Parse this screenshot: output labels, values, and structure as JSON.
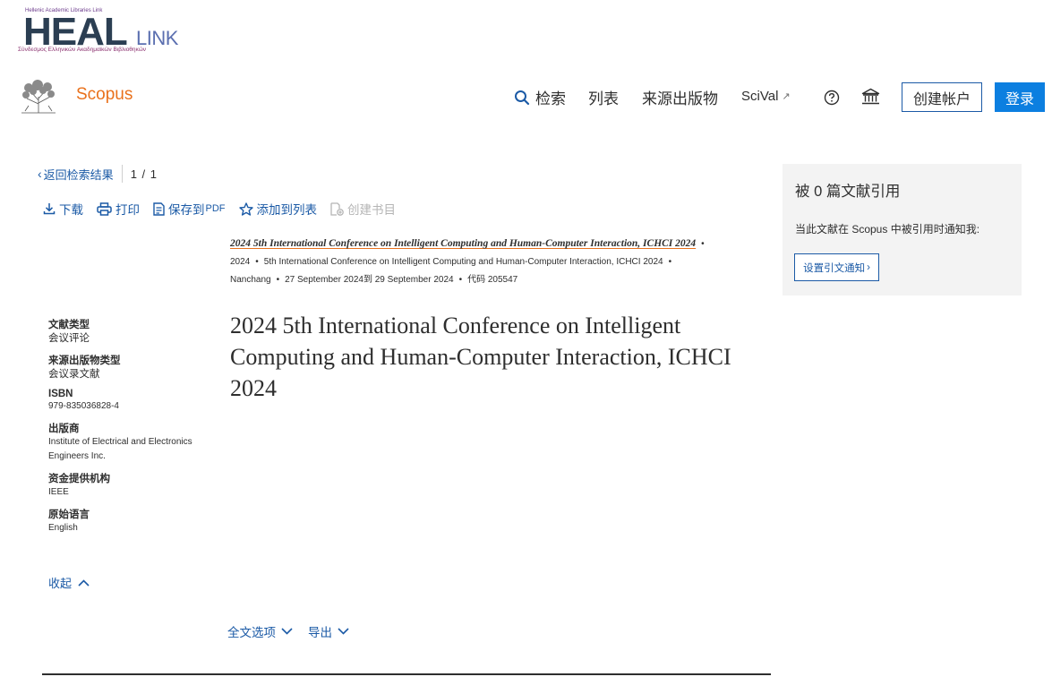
{
  "heal_banner": {
    "small_text": "Hellenic Academic Libraries Link",
    "big_text": "HEAL",
    "link_text": "LINK",
    "sub_text": "Σύνδεσμος Ελληνικών Ακαδημαϊκών Βιβλιοθηκών"
  },
  "header": {
    "brand": "Scopus",
    "nav": {
      "search": "检索",
      "lists": "列表",
      "sources": "来源出版物",
      "scival": "SciVal",
      "scival_ext": "↗"
    },
    "create_account": "创建帐户",
    "login": "登录",
    "icons": [
      "search-icon",
      "help-icon",
      "institution-icon",
      "external-link-icon"
    ]
  },
  "nav_row": {
    "back_label": "返回检索结果",
    "pager": "1 / 1"
  },
  "toolbar": {
    "download": "下载",
    "print": "打印",
    "save_pdf": "保存到",
    "save_pdf_suffix": "PDF",
    "add_to_list": "添加到列表",
    "create_bib": "创建书目"
  },
  "source": {
    "title": "2024 5th International Conference on Intelligent Computing and Human-Computer Interaction, ICHCI 2024",
    "year": "2024",
    "conf": "5th International Conference on Intelligent Computing and Human-Computer Interaction, ICHCI 2024",
    "location": "Nanchang",
    "dates": "27 September 2024到 29 September 2024",
    "code": "代码 205547"
  },
  "document": {
    "title": "2024 5th International Conference on Intelligent Computing and Human-Computer Interaction, ICHCI 2024"
  },
  "metadata": {
    "doc_type_label": "文献类型",
    "doc_type_value": "会议评论",
    "source_type_label": "来源出版物类型",
    "source_type_value": "会议录文献",
    "isbn_label": "ISBN",
    "isbn_value": "979-835036828-4",
    "publisher_label": "出版商",
    "publisher_value": "Institute of Electrical and Electronics Engineers Inc.",
    "funding_label": "资金提供机构",
    "funding_value": "IEEE",
    "language_label": "原始语言",
    "language_value": "English",
    "collapse": "收起"
  },
  "options": {
    "fulltext": "全文选项",
    "export": "导出"
  },
  "citation_panel": {
    "title": "被 0 篇文献引用",
    "notify_text": "当此文献在 Scopus 中被引用时通知我:",
    "button": "设置引文通知"
  },
  "colors": {
    "link_blue": "#1b5aa6",
    "brand_orange": "#e9711c",
    "login_blue": "#0c7fe0",
    "panel_gray": "#f3f3f3"
  }
}
